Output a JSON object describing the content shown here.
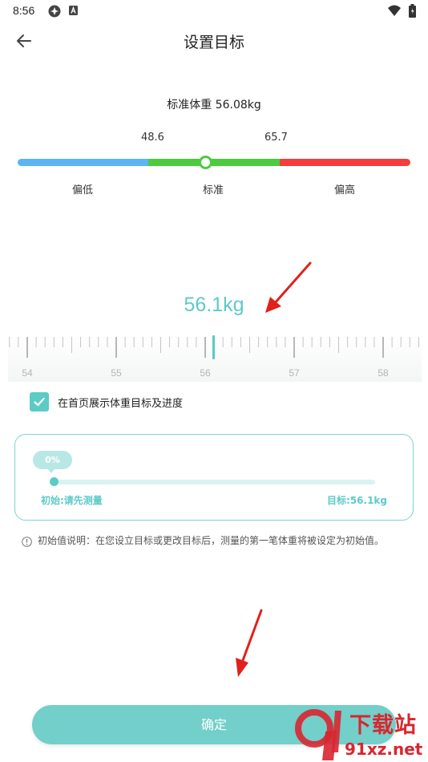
{
  "status_bar": {
    "time": "8:56"
  },
  "header": {
    "title": "设置目标",
    "back_icon": "arrow-left-icon"
  },
  "standard": {
    "weight_text": "标准体重 56.08kg",
    "range_low": "48.6",
    "range_high": "65.7",
    "labels": [
      "偏低",
      "标准",
      "偏高"
    ],
    "colors": {
      "low": "#5bb5f5",
      "normal": "#4ccb3f",
      "high": "#f53d3d"
    }
  },
  "target": {
    "value": "56.1kg",
    "ruler_labels": [
      "54",
      "55",
      "56",
      "57",
      "58"
    ],
    "accent_color": "#5ccbc6"
  },
  "checkbox": {
    "label": "在首页展示体重目标及进度",
    "checked": true
  },
  "progress": {
    "percent_label": "0%",
    "percent": 0,
    "start_label": "初始:请先测量",
    "goal_label": "目标:56.1kg"
  },
  "note": {
    "text": "初始值说明：在您设立目标或更改目标后，测量的第一笔体重将被设定为初始值。"
  },
  "confirm_label": "确定",
  "watermark": {
    "main": "下载站",
    "url": "91xz.net"
  }
}
